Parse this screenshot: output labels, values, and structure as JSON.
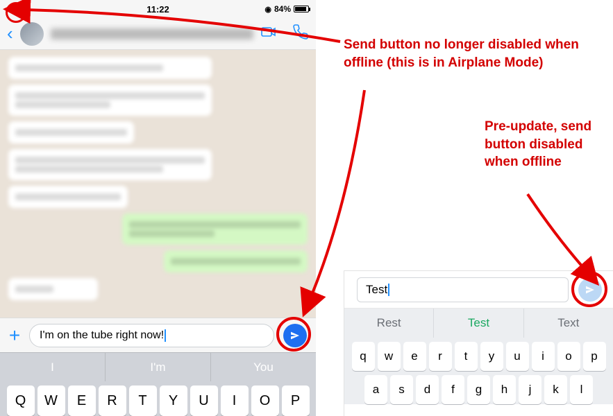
{
  "left": {
    "status": {
      "time": "11:22",
      "battery_pct": "84%",
      "airplane_icon": "airplane-icon"
    },
    "header": {
      "back_icon": "chevron-left-icon",
      "video_icon": "video-icon",
      "call_icon": "phone-icon"
    },
    "input": {
      "plus_label": "+",
      "message_value": "I'm on the tube right now!",
      "send_icon": "send-icon"
    },
    "suggestions": [
      "I",
      "I'm",
      "You"
    ],
    "keyboard_row": [
      "Q",
      "W",
      "E",
      "R",
      "T",
      "Y",
      "U",
      "I",
      "O",
      "P"
    ]
  },
  "right": {
    "input_value": "Test",
    "send_icon": "send-icon",
    "suggestions": [
      "Rest",
      "Test",
      "Text"
    ],
    "kb_row1": [
      "q",
      "w",
      "e",
      "r",
      "t",
      "y",
      "u",
      "i",
      "o",
      "p"
    ],
    "kb_row2": [
      "a",
      "s",
      "d",
      "f",
      "g",
      "h",
      "j",
      "k",
      "l"
    ]
  },
  "annotations": {
    "a1": "Send button no longer disabled when offline (this is in Airplane Mode)",
    "a2": "Pre-update, send button disabled when offline"
  }
}
